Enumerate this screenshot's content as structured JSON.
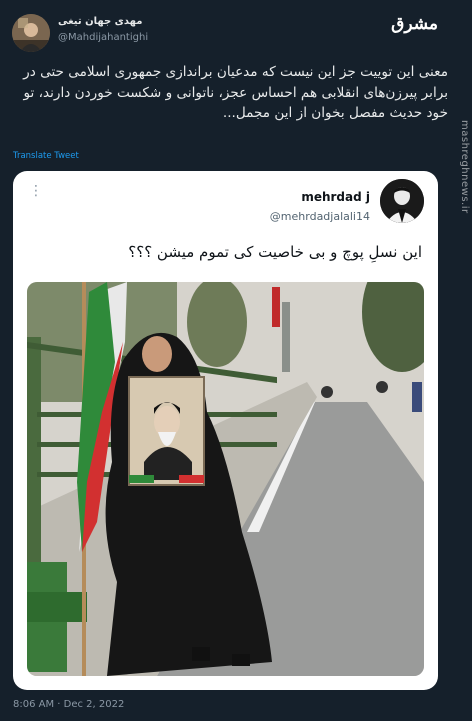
{
  "author": {
    "name": "مهدی جهان تیغی",
    "handle": "@Mahdijahantighi"
  },
  "logo_text": "مشرق",
  "watermark": "mashreghnews.ir",
  "tweet_text": "معنی این توییت جز این نیست که مدعیان براندازی جمهوری اسلامی حتی در برابر پیرزن‌های انقلابی هم احساس عجز، ناتوانی و شکست خوردن دارند، تو خود حدیث مفصل بخوان از این مجمل...",
  "translate_label": "Translate Tweet",
  "quoted_tweet": {
    "name": "mehrdad j",
    "handle": "@mehrdadjalali14",
    "text": "این نسلِ پوچ و بی خاصیت کی تموم میشن ؟؟؟",
    "more_glyph": "⋮",
    "image_alt": "Elderly woman in black chador holding a portrait and an Iranian flag on a street"
  },
  "timestamp": "8:06 AM · Dec 2, 2022",
  "colors": {
    "background": "#15202b",
    "link": "#1d9bf0",
    "card": "#ffffff"
  }
}
